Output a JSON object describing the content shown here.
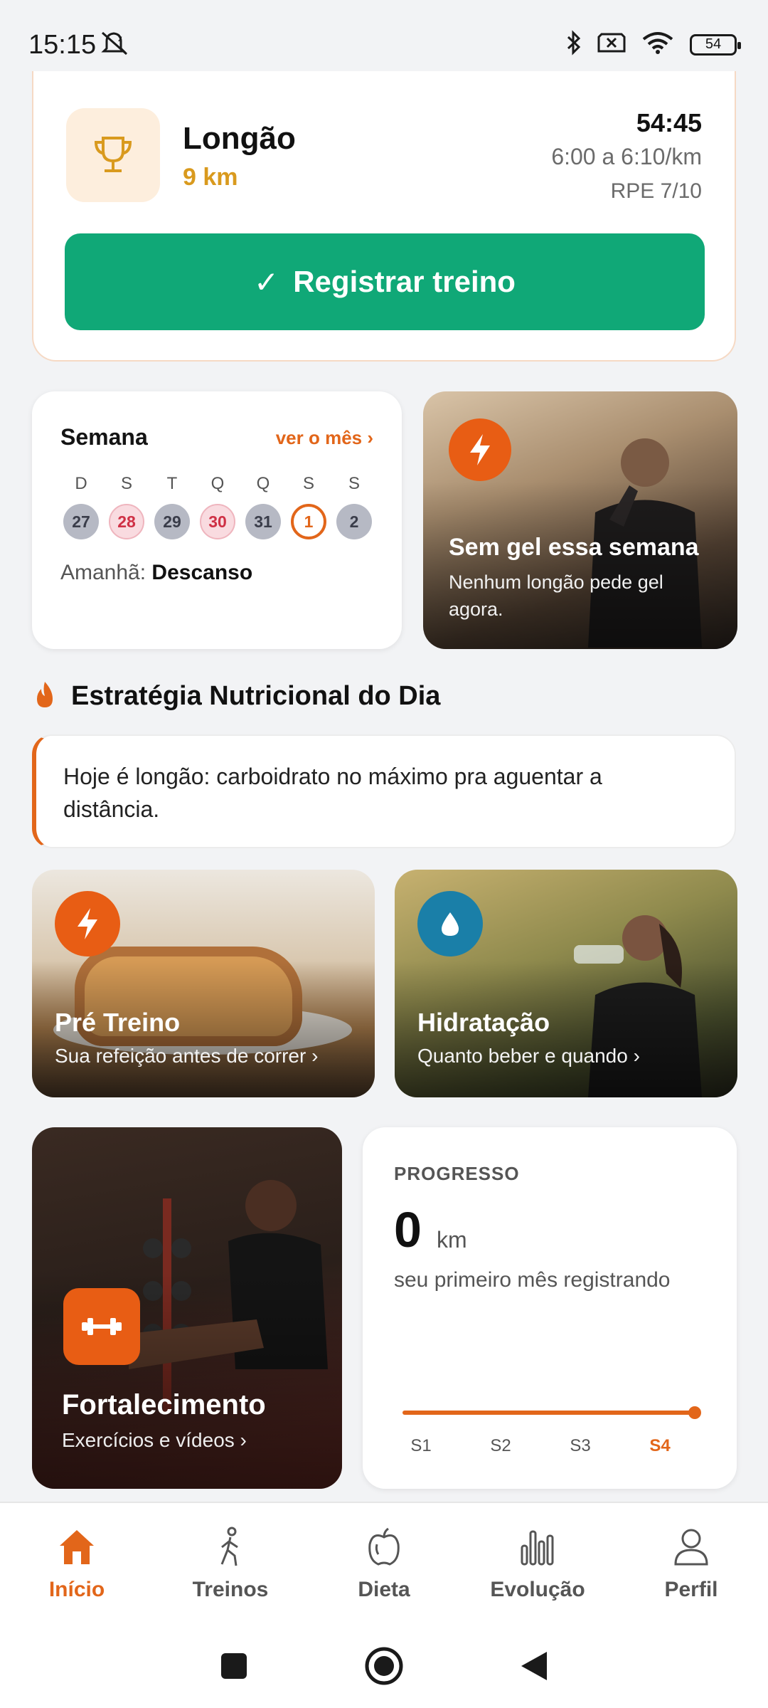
{
  "status_bar": {
    "time": "15:15",
    "battery": "54"
  },
  "workout": {
    "title": "Longão",
    "distance": "9 km",
    "time": "54:45",
    "pace": "6:00 a 6:10/km",
    "rpe": "RPE 7/10",
    "button_label": "Registrar treino",
    "button_check": "✓"
  },
  "week": {
    "title": "Semana",
    "link": "ver o mês ›",
    "days": [
      {
        "letter": "D",
        "num": "27",
        "state": "gray"
      },
      {
        "letter": "S",
        "num": "28",
        "state": "red"
      },
      {
        "letter": "T",
        "num": "29",
        "state": "gray"
      },
      {
        "letter": "Q",
        "num": "30",
        "state": "red"
      },
      {
        "letter": "Q",
        "num": "31",
        "state": "gray"
      },
      {
        "letter": "S",
        "num": "1",
        "state": "today"
      },
      {
        "letter": "S",
        "num": "2",
        "state": "gray"
      }
    ],
    "tomorrow_label": "Amanhã:",
    "tomorrow_value": "Descanso"
  },
  "gel": {
    "title": "Sem gel essa semana",
    "subtitle": "Nenhum longão pede gel agora."
  },
  "strategy": {
    "title": "Estratégia Nutricional do Dia",
    "text": "Hoje é longão: carboidrato no máximo pra aguentar a distância."
  },
  "pre_treino": {
    "title": "Pré Treino",
    "subtitle": "Sua refeição antes de correr ›"
  },
  "hidratacao": {
    "title": "Hidratação",
    "subtitle": "Quanto beber e quando ›"
  },
  "fortalecimento": {
    "title": "Fortalecimento",
    "subtitle": "Exercícios e vídeos ›"
  },
  "progress": {
    "label": "PROGRESSO",
    "value": "0",
    "unit": "km",
    "note": "seu primeiro mês registrando",
    "weeks": [
      "S1",
      "S2",
      "S3",
      "S4"
    ],
    "current_week": "S4"
  },
  "nav": {
    "items": [
      {
        "label": "Início",
        "icon": "home-icon",
        "active": true
      },
      {
        "label": "Treinos",
        "icon": "walk-icon",
        "active": false
      },
      {
        "label": "Dieta",
        "icon": "apple-icon",
        "active": false
      },
      {
        "label": "Evolução",
        "icon": "chart-icon",
        "active": false
      },
      {
        "label": "Perfil",
        "icon": "user-icon",
        "active": false
      }
    ]
  },
  "colors": {
    "accent": "#e2661a",
    "primary_button": "#10a877",
    "trophy_bg": "#fdeedd",
    "distance": "#d99a1e"
  }
}
